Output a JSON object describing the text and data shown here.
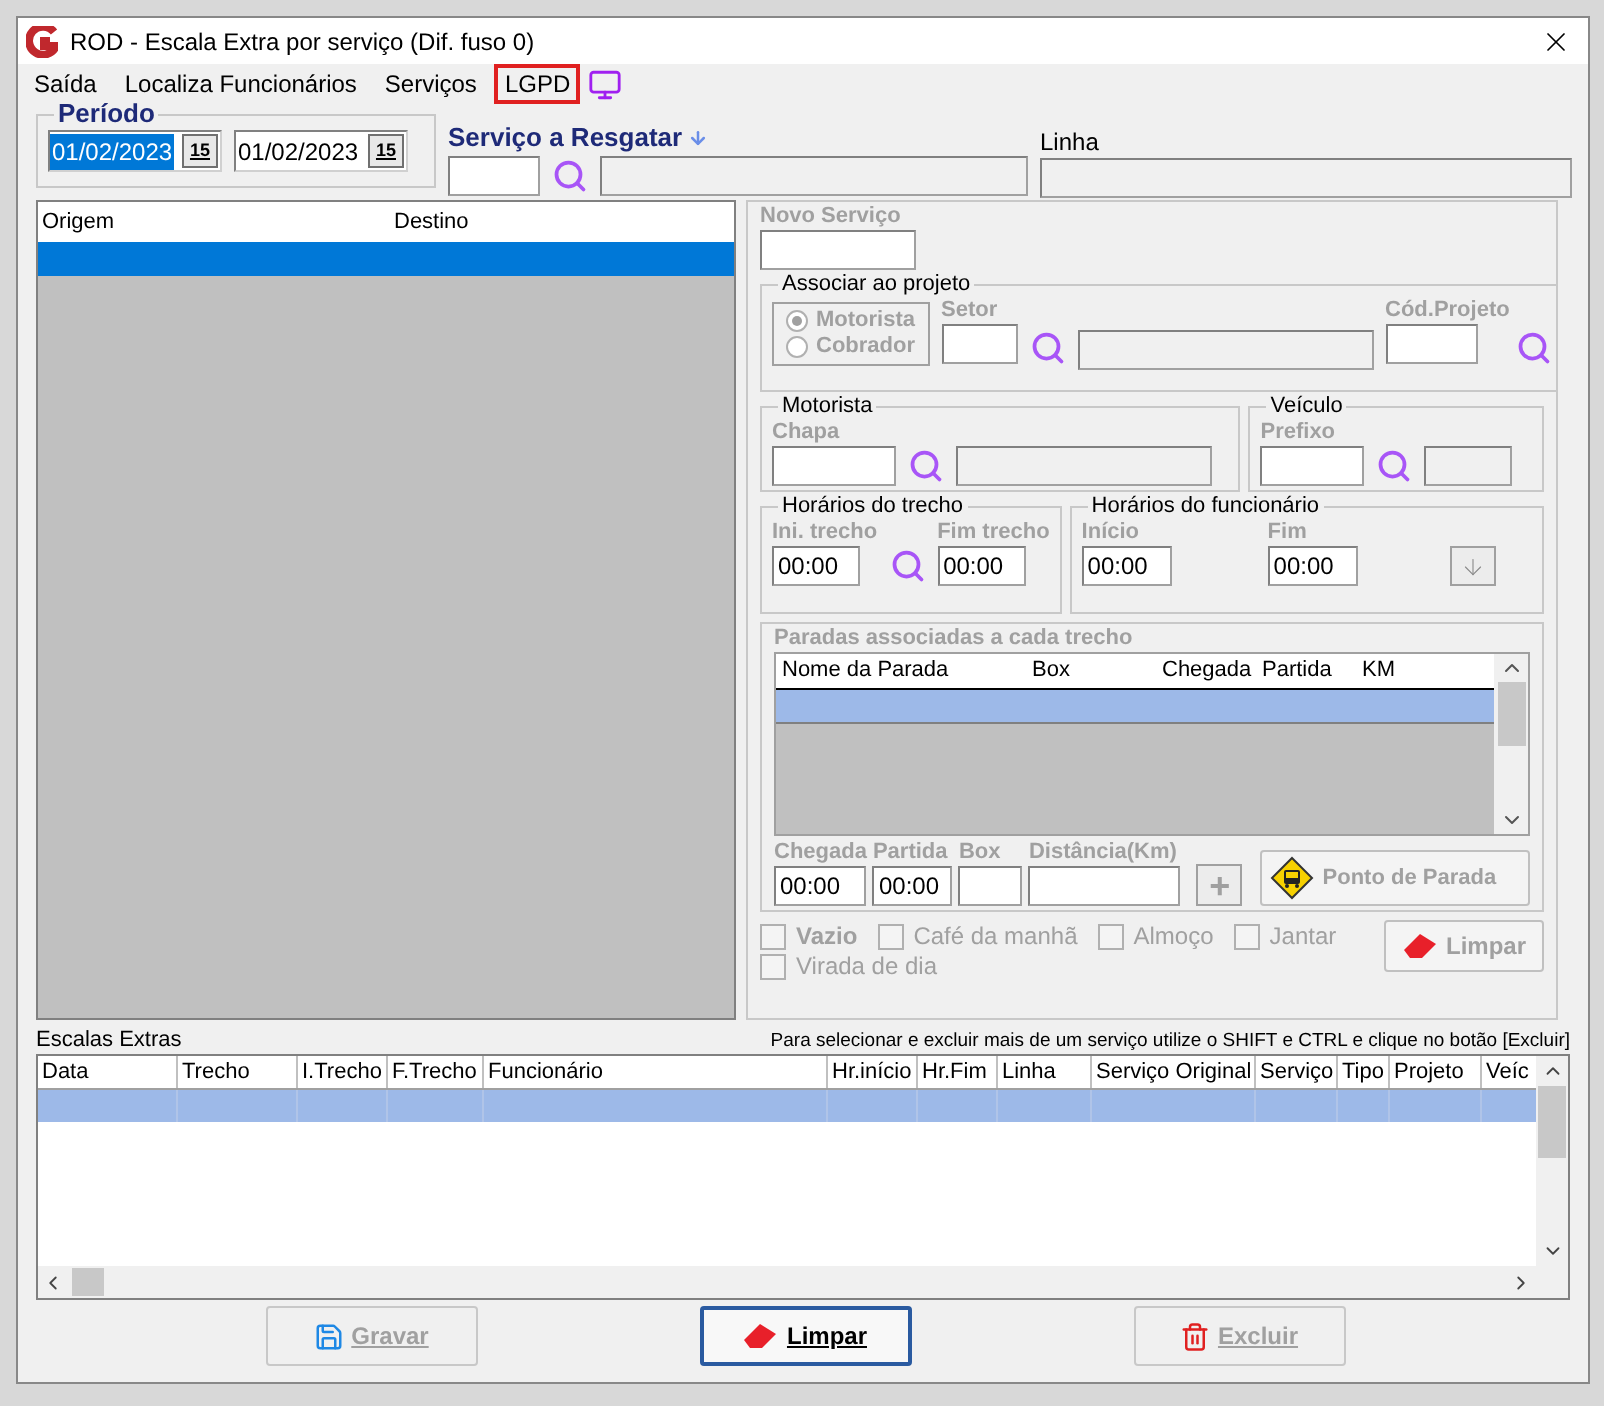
{
  "window": {
    "title": "ROD - Escala Extra por serviço (Dif. fuso 0)"
  },
  "menu": [
    {
      "label": "Saída",
      "highlighted": false
    },
    {
      "label": "Localiza Funcionários",
      "highlighted": false
    },
    {
      "label": "Serviços",
      "highlighted": false
    },
    {
      "label": "LGPD",
      "highlighted": true
    }
  ],
  "periodo": {
    "label": "Período",
    "dates": [
      {
        "value": "01/02/2023",
        "selected": true,
        "calendar": "15"
      },
      {
        "value": "01/02/2023",
        "selected": false,
        "calendar": "15"
      }
    ]
  },
  "servico": {
    "label": "Serviço a Resgatar"
  },
  "linha": {
    "label": "Linha"
  },
  "route_list": {
    "columns": [
      "Origem",
      "Destino"
    ],
    "rows": [
      {
        "selected": true
      }
    ]
  },
  "editor": {
    "disabled": true,
    "novo_servico": "Novo Serviço",
    "associar": {
      "title": "Associar ao projeto",
      "options": [
        {
          "label": "Motorista",
          "selected": true
        },
        {
          "label": "Cobrador",
          "selected": false
        }
      ],
      "setor": "Setor",
      "cod_projeto": "Cód.Projeto"
    },
    "motorista": {
      "title": "Motorista",
      "label": "Chapa"
    },
    "veiculo": {
      "title": "Veículo",
      "label": "Prefixo"
    },
    "horarios_trecho": {
      "title": "Horários do trecho",
      "fields": [
        {
          "label": "Ini. trecho",
          "value": "00:00"
        },
        {
          "label": "Fim trecho",
          "value": "00:00"
        }
      ]
    },
    "horarios_funcionario": {
      "title": "Horários do funcionário",
      "fields": [
        {
          "label": "Início",
          "value": "00:00"
        },
        {
          "label": "Fim",
          "value": "00:00"
        }
      ]
    },
    "paradas": {
      "title": "Paradas associadas a cada trecho",
      "columns": [
        "Nome da Parada",
        "Box",
        "Chegada",
        "Partida",
        "KM"
      ],
      "rows": [
        {
          "selected": true
        }
      ],
      "entry": [
        {
          "label": "Chegada",
          "value": "00:00"
        },
        {
          "label": "Partida",
          "value": "00:00"
        },
        {
          "label": "Box"
        },
        {
          "label": "Distância(Km)"
        }
      ],
      "add": "+",
      "ponto": "Ponto de Parada"
    },
    "options": [
      {
        "label": "Vazio",
        "checked": false,
        "bold": true
      },
      {
        "label": "Café da manhã",
        "checked": false,
        "bold": false
      },
      {
        "label": "Almoço",
        "checked": false,
        "bold": false
      },
      {
        "label": "Jantar",
        "checked": false,
        "bold": false
      },
      {
        "label": "Virada de dia",
        "checked": false,
        "bold": false
      }
    ],
    "clear": "Limpar"
  },
  "escalas": {
    "title": "Escalas Extras",
    "hint": "Para selecionar e excluir mais de um serviço utilize o SHIFT e CTRL e clique no botão [Excluir]",
    "columns": [
      "Data",
      "Trecho",
      "I.Trecho",
      "F.Trecho",
      "Funcionário",
      "Hr.início",
      "Hr.Fim",
      "Linha",
      "Serviço Original",
      "Serviço",
      "Tipo",
      "Projeto",
      "Veíc"
    ],
    "rows": [
      {
        "selected": true
      }
    ]
  },
  "buttons": [
    {
      "kind": "save",
      "label": "Gravar",
      "disabled": true,
      "default": false
    },
    {
      "kind": "clear",
      "label": "Limpar",
      "disabled": false,
      "default": true
    },
    {
      "kind": "delete",
      "label": "Excluir",
      "disabled": true,
      "default": false
    }
  ]
}
